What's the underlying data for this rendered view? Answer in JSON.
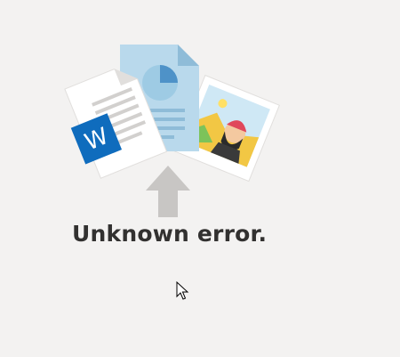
{
  "message": {
    "title": "Unknown error."
  },
  "illustration": {
    "word_letter": "W",
    "icons": [
      "word-document-icon",
      "chart-document-icon",
      "photo-icon",
      "upload-arrow-icon"
    ]
  },
  "colors": {
    "background": "#f3f2f1",
    "word_blue": "#0f6cbd",
    "arrow_gray": "#c8c6c4",
    "text": "#323130"
  }
}
